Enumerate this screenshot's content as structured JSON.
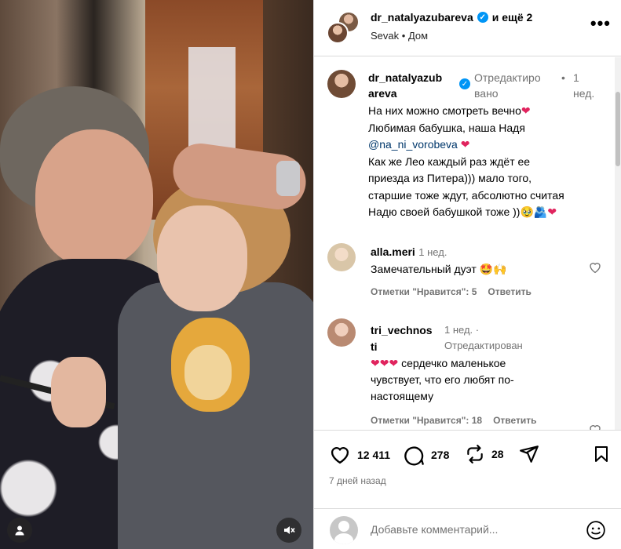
{
  "header": {
    "username": "dr_natalyazubareva",
    "collab_suffix": "и ещё 2",
    "audio": "Sevak",
    "separator": "•",
    "location": "Дом",
    "more_label": "•••"
  },
  "caption": {
    "username_line1": "dr_natalyazub",
    "username_line2": "areva",
    "edited_line1": "Отредактиро",
    "edited_line2": "вано",
    "dot": "•",
    "time_line1": "1",
    "time_line2": "нед.",
    "line1": "На них можно смотреть вечно",
    "line2": "Любимая бабушка, наша Надя",
    "mention": "@na_ni_vorobeva",
    "line3": "Как же Лео каждый раз ждёт ее",
    "line4": "приезда из Питера))) мало того,",
    "line5": "старшие тоже ждут, абсолютно считая",
    "line6": "Надю своей бабушкой тоже ))",
    "emoji_heart": "❤",
    "emoji_tail": "🥹🫂"
  },
  "comments": [
    {
      "username": "alla.meri",
      "time": "1 нед.",
      "text": "Замечательный дуэт",
      "emoji": "🤩🙌",
      "likes_label": "Отметки \"Нравится\": 5",
      "reply_label": "Ответить"
    },
    {
      "username_line1": "tri_vechnos",
      "username_line2": "ti",
      "time": "1 нед. ·",
      "edited": "Отредактирован",
      "hearts": "❤❤❤",
      "text_line1": "сердечко маленькое",
      "text_line2": "чувствует, что его любят по-",
      "text_line3": "настоящему",
      "likes_label": "Отметки \"Нравится\": 18",
      "reply_label": "Ответить"
    }
  ],
  "actions": {
    "likes": "12 411",
    "comments": "278",
    "reposts": "28",
    "date": "7 дней назад"
  },
  "add_comment": {
    "placeholder": "Добавьте комментарий..."
  },
  "colors": {
    "verified": "#0095f6",
    "muted_text": "#737373",
    "mention": "#00376b",
    "heart": "#e0245e",
    "border": "#dbdbdb"
  }
}
